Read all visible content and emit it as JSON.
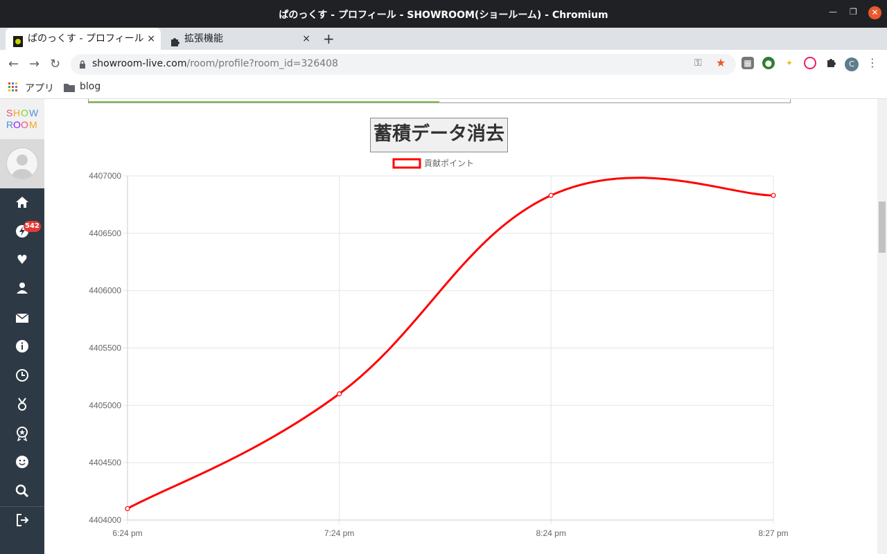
{
  "window": {
    "title": "ぱのっくす - プロフィール - SHOWROOM(ショールーム) - Chromium"
  },
  "tabs": [
    {
      "label": "ぱのっくす - プロフィール",
      "close": "×"
    },
    {
      "label": "拡張機能",
      "close": "×"
    }
  ],
  "new_tab": "+",
  "address": {
    "host": "showroom-live.com",
    "path": "/room/profile?room_id=326408"
  },
  "bookmarks": {
    "apps": "アプリ",
    "folder": "blog"
  },
  "profile_initial": "C",
  "sidebar": {
    "logo_top": "SHOW",
    "logo_bottom": "ROOM",
    "notification_count": "542"
  },
  "page": {
    "progress": 0.5,
    "clear_button": "蓄積データ消去"
  },
  "chart_data": {
    "type": "line",
    "legend": "貢献ポイント",
    "legend_position": "top-center",
    "x": [
      "6:24 pm",
      "7:24 pm",
      "8:24 pm",
      "8:27 pm"
    ],
    "x_minutes": [
      0,
      60,
      120,
      183
    ],
    "series": [
      {
        "name": "貢献ポイント",
        "color": "#ff0000",
        "values": [
          4404100,
          4405100,
          4406830,
          4406830
        ]
      }
    ],
    "y_ticks": [
      4404000,
      4404500,
      4405000,
      4405500,
      4406000,
      4406500,
      4407000
    ],
    "ylim": [
      4404000,
      4407000
    ],
    "grid": true
  }
}
